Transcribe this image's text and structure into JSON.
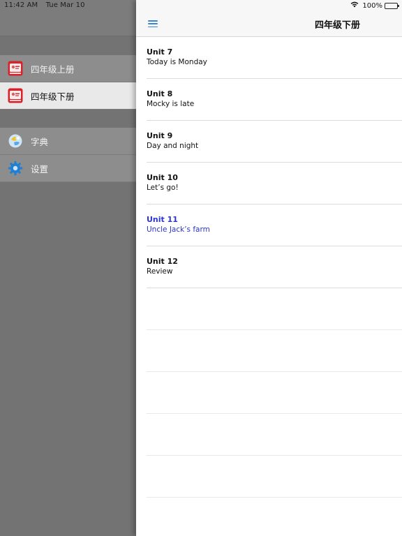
{
  "status_bar": {
    "time": "11:42 AM",
    "date": "Tue Mar 10",
    "battery": "100%"
  },
  "sidebar": {
    "books": [
      {
        "label": "四年级上册",
        "icon": "book-cover-icon",
        "selected": false
      },
      {
        "label": "四年级下册",
        "icon": "book-cover-icon",
        "selected": true
      }
    ],
    "tools": [
      {
        "label": "字典",
        "icon": "dictionary-icon"
      },
      {
        "label": "设置",
        "icon": "gear-icon"
      }
    ]
  },
  "main": {
    "title": "四年级下册",
    "menu_icon": "hamburger-menu-icon",
    "units": [
      {
        "title": "Unit 7",
        "subtitle": "Today is Monday",
        "active": false
      },
      {
        "title": "Unit 8",
        "subtitle": "Mocky is late",
        "active": false
      },
      {
        "title": "Unit 9",
        "subtitle": "Day and night",
        "active": false
      },
      {
        "title": "Unit 10",
        "subtitle": "Let’s go!",
        "active": false
      },
      {
        "title": "Unit 11",
        "subtitle": "Uncle Jack’s farm",
        "active": true
      },
      {
        "title": "Unit 12",
        "subtitle": "Review",
        "active": false
      }
    ]
  },
  "colors": {
    "accent_link": "#2c35c9",
    "menu_icon": "#3a86d4",
    "dimmed_sidebar": "#737373"
  }
}
